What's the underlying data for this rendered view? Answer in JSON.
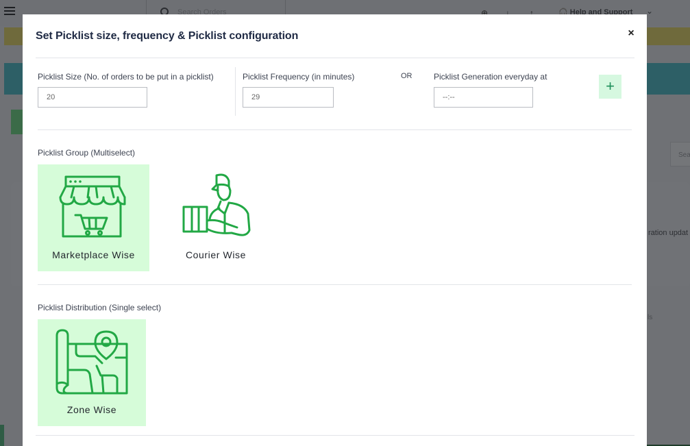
{
  "background": {
    "search_placeholder": "Search Orders",
    "help_label": "Help and Support",
    "search_box_text": "Sea",
    "text_fragment_1": "ration updat",
    "text_fragment_2": "ls"
  },
  "modal": {
    "title": "Set Picklist size, frequency & Picklist configuration",
    "close_label": "×",
    "fields": {
      "size": {
        "label": "Picklist Size (No. of orders to be put in a picklist)",
        "value": "20"
      },
      "frequency": {
        "label": "Picklist Frequency (in minutes)",
        "value": "29"
      },
      "or_label": "OR",
      "generation": {
        "label": "Picklist Generation everyday at",
        "value": "--:--"
      },
      "add_label": "+"
    },
    "group": {
      "label": "Picklist Group (Multiselect)",
      "options": [
        {
          "label": "Marketplace Wise",
          "selected": true,
          "icon": "storefront-cart-icon"
        },
        {
          "label": "Courier Wise",
          "selected": false,
          "icon": "delivery-person-icon"
        }
      ]
    },
    "distribution": {
      "label": "Picklist Distribution (Single select)",
      "options": [
        {
          "label": "Zone Wise",
          "selected": true,
          "icon": "map-pin-icon"
        }
      ]
    }
  },
  "colors": {
    "accent_green": "#22a845",
    "selected_bg": "#d6fcd9",
    "plus_bg": "#d6f8e0",
    "title": "#1f2a44"
  }
}
